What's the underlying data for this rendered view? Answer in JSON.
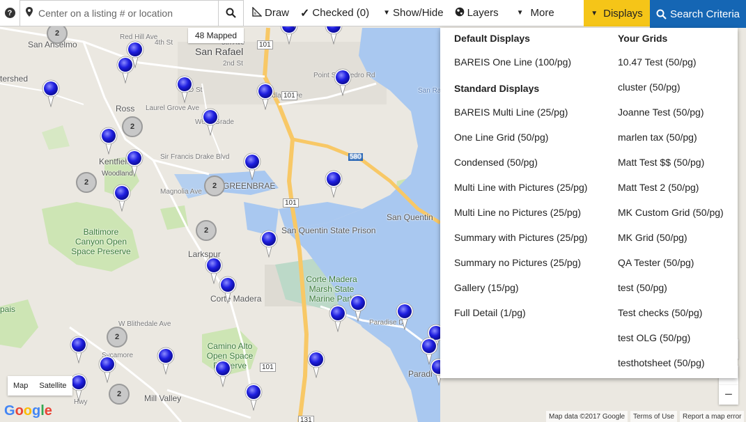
{
  "topbar": {
    "help_label": "?",
    "search_placeholder": "Center on a listing # or location",
    "draw_label": "Draw",
    "checked_label": "Checked (0)",
    "showhide_label": "Show/Hide",
    "layers_label": "Layers",
    "more_label": "More",
    "displays_label": "Displays",
    "search_criteria_label": "Search Criteria"
  },
  "map": {
    "mapped_count_label": "48 Mapped",
    "places": {
      "san_anselmo": "San Anselmo",
      "san_rafael": "San Rafael",
      "ross": "Ross",
      "kentfield": "Kentfield",
      "greenbrae": "GREENBRAE",
      "larkspur": "Larkspur",
      "corte_madera": "Corte Madera",
      "mill_valley": "Mill Valley",
      "san_quentin_prison": "San Quentin State Prison",
      "san_quentin": "San Quentin",
      "baltimore_canyon": "Baltimore Canyon Open Space Preserve",
      "corte_madera_marsh": "Corte Madera Marsh State Marine Park",
      "camino_alto": "Camino Alto Open Space Preserve",
      "paradise": "Paradi",
      "tershed": "tershed",
      "pais": "pais",
      "red_hill": "Red Hill Ave",
      "fourth_st": "4th St",
      "fifth_ave": "5th Ave",
      "second_st": "2nd St",
      "d_st": "D St",
      "woodland": "Woodland",
      "laurel_grove": "Laurel Grove Ave",
      "wolfe_grade": "Wolfe Grade",
      "sir_francis_drake": "Sir Francis Drake Blvd",
      "magnolia": "Magnolia Ave",
      "point_san_pedro": "Point San Pedro Rd",
      "san_rafael_rock": "San Rafael",
      "paradise_dr": "Paradise Dr",
      "sycamore": "Sycamore",
      "w_blithedale": "W Blithedale Ave",
      "shoreline_hwy": "Hwy",
      "route_101a": "101",
      "route_101b": "101",
      "route_101c": "101",
      "route_101d": "101",
      "route_580": "580",
      "route_131": "131",
      "woodland_ave": "Woodland Ave"
    },
    "clusters": [
      "2",
      "2",
      "2",
      "2",
      "2",
      "2",
      "2"
    ],
    "map_type_map": "Map",
    "map_type_satellite": "Satellite",
    "zoom_in": "+",
    "zoom_out": "−",
    "google_logo": "Google",
    "footer_mapdata": "Map data ©2017 Google",
    "footer_terms": "Terms of Use",
    "footer_report": "Report a map error"
  },
  "displays_menu": {
    "default_heading": "Default Displays",
    "default_items": [
      "BAREIS One Line (100/pg)"
    ],
    "standard_heading": "Standard Displays",
    "standard_items": [
      "BAREIS Multi Line (25/pg)",
      "One Line Grid (50/pg)",
      "Condensed (50/pg)",
      "Multi Line with Pictures (25/pg)",
      "Multi Line no Pictures (25/pg)",
      "Summary with Pictures (25/pg)",
      "Summary no Pictures (25/pg)",
      "Gallery (15/pg)",
      "Full Detail (1/pg)"
    ],
    "grids_heading": "Your Grids",
    "grid_items": [
      "10.47 Test (50/pg)",
      "cluster (50/pg)",
      "Joanne Test (50/pg)",
      "marlen tax (50/pg)",
      "Matt Test $$ (50/pg)",
      "Matt Test 2 (50/pg)",
      "MK Custom Grid (50/pg)",
      "MK Grid (50/pg)",
      "QA Tester (50/pg)",
      "test (50/pg)",
      "Test checks (50/pg)",
      "test OLG (50/pg)",
      "testhotsheet (50/pg)"
    ]
  },
  "colors": {
    "water": "#a9c8f0",
    "park": "#cde5b4",
    "highway": "#f8c866",
    "displays_bg": "#f5c518",
    "search_criteria_bg": "#1566b4",
    "pin": "#2020e0"
  }
}
